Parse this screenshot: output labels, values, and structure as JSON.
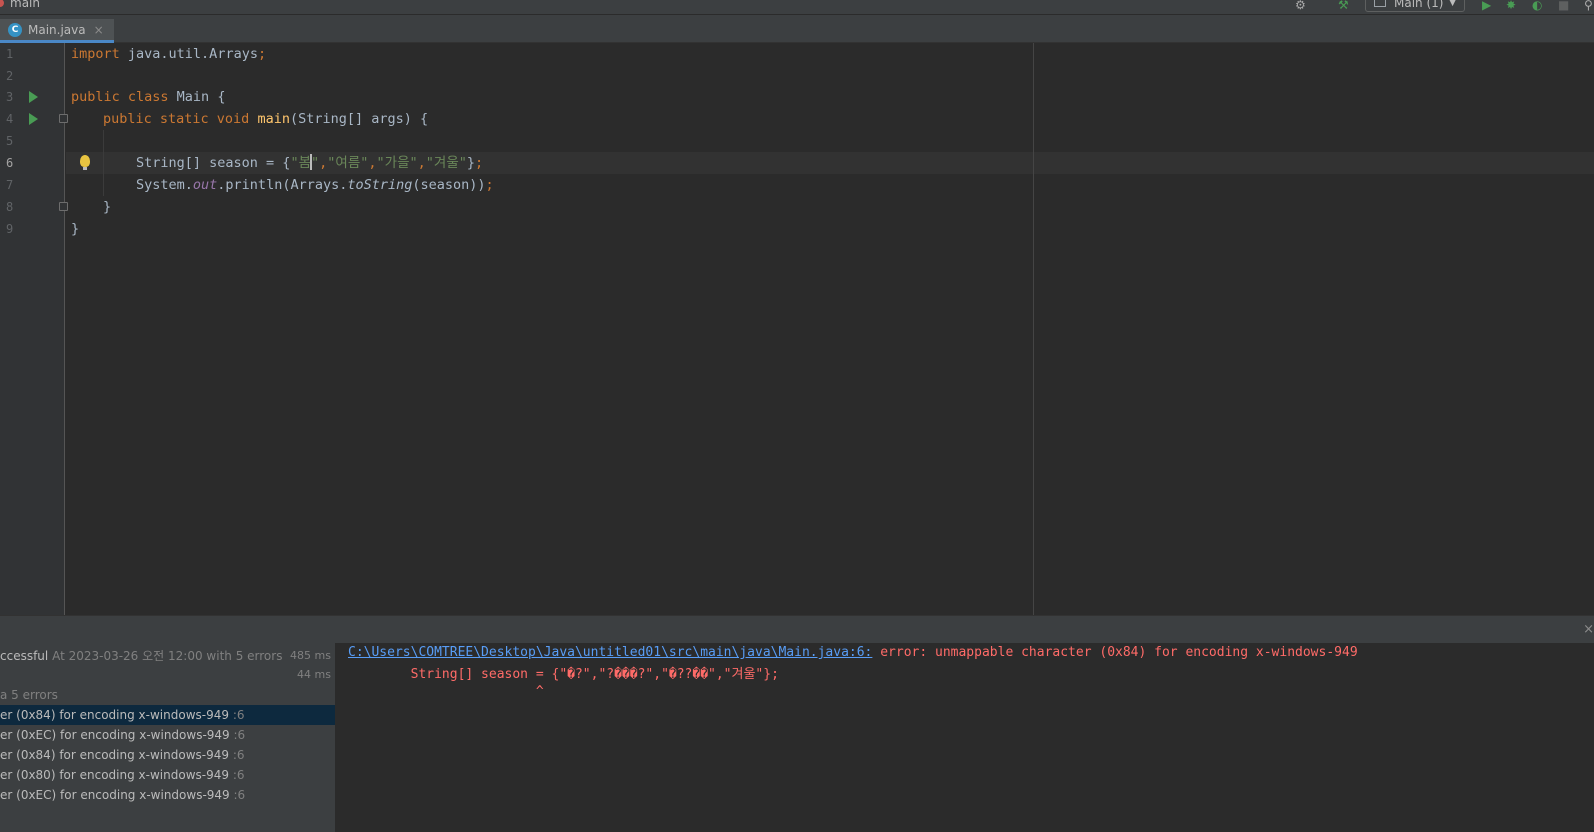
{
  "topbar": {
    "branch": "main",
    "run_config": "Main (1)"
  },
  "tabs": [
    {
      "label": "Main.java",
      "close": "×"
    }
  ],
  "editor": {
    "line_numbers": [
      "1",
      "2",
      "3",
      "4",
      "5",
      "6",
      "7",
      "8",
      "9"
    ],
    "current_line": 6,
    "lines": {
      "l1_kw": "import",
      "l1_rest": " java.util.Arrays",
      "l1_semi": ";",
      "l3_kw": "public class",
      "l3_rest": " Main {",
      "l4_kw": "public static void",
      "l4_fn": "main",
      "l4_rest": "(String[] args) {",
      "l6_a": "String[] season = {",
      "l6_s1a": "\"봄",
      "l6_s1b": "\"",
      "l6_c1": ",",
      "l6_s2": "\"여름\"",
      "l6_c2": ",",
      "l6_s3": "\"가을\"",
      "l6_c3": ",",
      "l6_s4": "\"겨울\"",
      "l6_end": "}",
      "l6_semi": ";",
      "l7_a": "System.",
      "l7_out": "out",
      "l7_b": ".println(Arrays.",
      "l7_ts": "toString",
      "l7_c": "(season))",
      "l7_semi": ";",
      "l8": "}",
      "l9": "}"
    }
  },
  "build": {
    "tree": [
      {
        "text": "ccessful",
        "gray": " At 2023-03-26 오전 12:00 with 5 errors",
        "time": "485 ms",
        "selected": false
      },
      {
        "text": "",
        "gray": "",
        "time": "44 ms",
        "selected": false
      },
      {
        "text": "a 5 errors",
        "gray": "",
        "time": "",
        "selected": false
      },
      {
        "text": "er (0x84) for encoding x-windows-949",
        "gray": " :6",
        "time": "",
        "selected": true
      },
      {
        "text": "er (0xEC) for encoding x-windows-949",
        "gray": " :6",
        "time": "",
        "selected": false
      },
      {
        "text": "er (0x84) for encoding x-windows-949",
        "gray": " :6",
        "time": "",
        "selected": false
      },
      {
        "text": "er (0x80) for encoding x-windows-949",
        "gray": " :6",
        "time": "",
        "selected": false
      },
      {
        "text": "er (0xEC) for encoding x-windows-949",
        "gray": " :6",
        "time": "",
        "selected": false
      }
    ],
    "console": {
      "path": "C:\\Users\\COMTREE\\Desktop\\Java\\untitled01\\src\\main\\java\\Main.java:6:",
      "error": " error: unmappable character (0x84) for encoding x-windows-949",
      "source": "        String[] season = {\"�?\",\"?���?\",\"�??��\",\"겨울\"};",
      "marker": "                        ^"
    }
  }
}
